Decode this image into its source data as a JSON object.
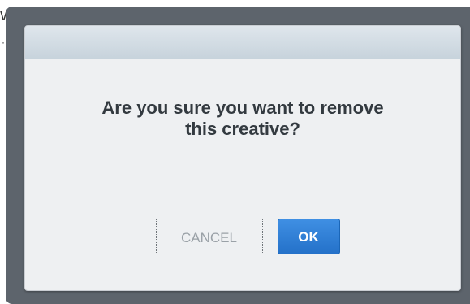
{
  "background": {
    "fragment_1": "W",
    "fragment_2": "·"
  },
  "dialog": {
    "message_line_1": "Are you sure you want to remove",
    "message_line_2": "this creative?",
    "cancel_label": "CANCEL",
    "ok_label": "OK"
  },
  "colors": {
    "overlay": "#5d646c",
    "dialog_body": "#eef0f2",
    "header_top": "#dfe6ec",
    "header_bottom": "#c7d3dc",
    "ok_button": "#2a78d0",
    "cancel_text": "#9aa1a7"
  }
}
